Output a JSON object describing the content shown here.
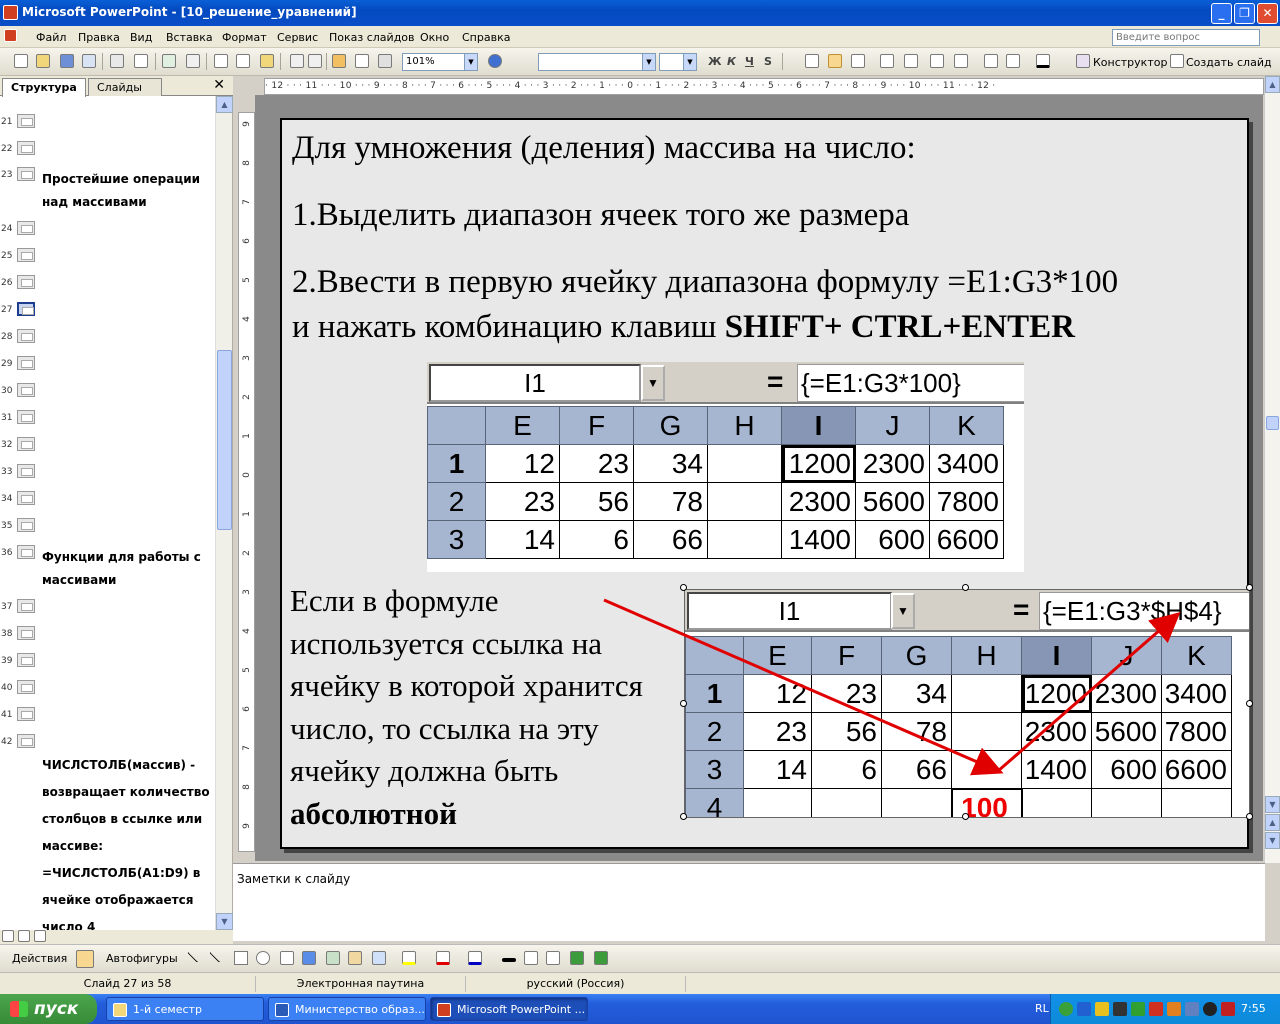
{
  "window": {
    "title": "Microsoft PowerPoint - [10_решение_уравнений]",
    "buttons": [
      "_",
      "❐",
      "✕"
    ]
  },
  "menu": {
    "items": [
      "Файл",
      "Правка",
      "Вид",
      "Вставка",
      "Формат",
      "Сервис",
      "Показ слайдов",
      "Окно",
      "Справка"
    ],
    "ask_placeholder": "Введите вопрос"
  },
  "toolbar": {
    "zoom": "101%",
    "format_letters": [
      "Ж",
      "К",
      "Ч",
      "S"
    ],
    "designer_label": "Конструктор",
    "new_slide_label": "Создать слайд"
  },
  "left_pane": {
    "tabs": [
      "Структура",
      "Слайды"
    ],
    "close": "✕",
    "rows": [
      {
        "num": "21",
        "text": ""
      },
      {
        "num": "22",
        "text": ""
      },
      {
        "num": "23",
        "text": "Простейшие операции над массивами"
      },
      {
        "num": "24",
        "text": ""
      },
      {
        "num": "25",
        "text": ""
      },
      {
        "num": "26",
        "text": ""
      },
      {
        "num": "27",
        "text": "",
        "selected": true
      },
      {
        "num": "28",
        "text": ""
      },
      {
        "num": "29",
        "text": ""
      },
      {
        "num": "30",
        "text": ""
      },
      {
        "num": "31",
        "text": ""
      },
      {
        "num": "32",
        "text": ""
      },
      {
        "num": "33",
        "text": ""
      },
      {
        "num": "34",
        "text": ""
      },
      {
        "num": "35",
        "text": ""
      },
      {
        "num": "36",
        "text": "Функции для работы с массивами"
      },
      {
        "num": "37",
        "text": ""
      },
      {
        "num": "38",
        "text": ""
      },
      {
        "num": "39",
        "text": ""
      },
      {
        "num": "40",
        "text": ""
      },
      {
        "num": "41",
        "text": ""
      },
      {
        "num": "42",
        "text": ""
      }
    ],
    "trailing_text": "ЧИСЛСТОЛБ(массив) - возвращает количество столбцов в ссылке или массиве: =ЧИСЛСТОЛБ(A1:D9) в ячейке отображается число 4"
  },
  "ruler": {
    "horizontal": "· 12 · · · 11 · · · 10 · · · 9 · · · 8 · · · 7 · · · 6 · · · 5 · · · 4 · · · 3 · · · 2 · · · 1 · · · 0 · · · 1 · · · 2 · · · 3 · · · 4 · · · 5 · · · 6 · · · 7 · · · 8 · · · 9 · · · 10 · · · 11 · · · 12 ·",
    "vertical": [
      "9",
      "8",
      "7",
      "6",
      "5",
      "4",
      "3",
      "2",
      "1",
      "0",
      "1",
      "2",
      "3",
      "4",
      "5",
      "6",
      "7",
      "8",
      "9"
    ]
  },
  "slide": {
    "heading": "Для умножения (деления) массива на число:",
    "step1": "1.Выделить диапазон ячеек того же  размера",
    "step2_line1": "2.Ввести в первую ячейку диапазона формулу =E1:G3*100",
    "step2_line2_prefix": "и нажать комбинацию клавиш ",
    "step2_keys": "SHIFT+ CTRL+ENTER",
    "note_lines": [
      "Если в формуле",
      "используется ссылка на",
      "ячейку в которой хранится",
      "число, то ссылка на эту",
      "ячейку должна быть"
    ],
    "note_bold": "абсолютной"
  },
  "excel1": {
    "namebox": "I1",
    "dropdown": "▼",
    "equals": "=",
    "formula": "{=E1:G3*100}",
    "cols": [
      "E",
      "F",
      "G",
      "H",
      "I",
      "J",
      "K"
    ],
    "rows": [
      {
        "h": "1",
        "cells": [
          "12",
          "23",
          "34",
          "",
          "1200",
          "2300",
          "3400"
        ]
      },
      {
        "h": "2",
        "cells": [
          "23",
          "56",
          "78",
          "",
          "2300",
          "5600",
          "7800"
        ]
      },
      {
        "h": "3",
        "cells": [
          "14",
          "6",
          "66",
          "",
          "1400",
          "600",
          "6600"
        ]
      }
    ]
  },
  "excel2": {
    "namebox": "I1",
    "dropdown": "▼",
    "equals": "=",
    "formula": "{=E1:G3*$H$4}",
    "cols": [
      "E",
      "F",
      "G",
      "H",
      "I",
      "J",
      "K"
    ],
    "rows": [
      {
        "h": "1",
        "cells": [
          "12",
          "23",
          "34",
          "",
          "1200",
          "2300",
          "3400"
        ]
      },
      {
        "h": "2",
        "cells": [
          "23",
          "56",
          "78",
          "",
          "2300",
          "5600",
          "7800"
        ]
      },
      {
        "h": "3",
        "cells": [
          "14",
          "6",
          "66",
          "",
          "1400",
          "600",
          "6600"
        ]
      },
      {
        "h": "4",
        "cells": [
          "",
          "",
          "",
          "100",
          "",
          "",
          ""
        ]
      }
    ]
  },
  "notes": {
    "text": "Заметки к слайду"
  },
  "drawbar": {
    "actions": "Действия",
    "autoshapes": "Автофигуры"
  },
  "status": {
    "slide": "Слайд 27 из 58",
    "design": "Электронная паутина",
    "lang": "русский (Россия)"
  },
  "taskbar": {
    "start": "пуск",
    "tasks": [
      "1-й семестр",
      "Министерство образ...",
      "Microsoft PowerPoint ..."
    ],
    "lang": "RL",
    "time": "7:55"
  },
  "colors": {
    "title_bar": "#0349c0",
    "highlight_red": "#e00000",
    "header_blue": "#a6b6d0"
  }
}
